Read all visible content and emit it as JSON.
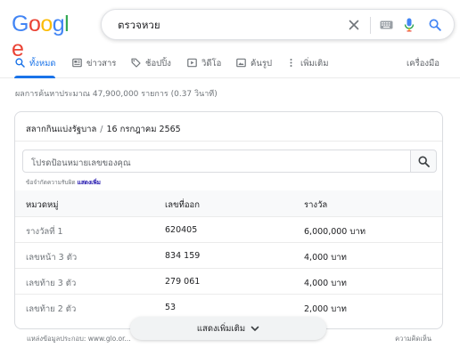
{
  "header": {
    "logo_letters": [
      {
        "ch": "G",
        "color": "#4285f4"
      },
      {
        "ch": "o",
        "color": "#ea4335"
      },
      {
        "ch": "o",
        "color": "#fbbc05"
      },
      {
        "ch": "g",
        "color": "#4285f4"
      },
      {
        "ch": "l",
        "color": "#34a853"
      },
      {
        "ch": "e",
        "color": "#ea4335"
      }
    ],
    "search_query": "ตรวจหวย",
    "icons": [
      "close-icon",
      "keyboard-icon",
      "mic-icon",
      "search-icon"
    ]
  },
  "tabs": {
    "all": "ทั้งหมด",
    "news": "ข่าวสาร",
    "shopping": "ช้อปปิ้ง",
    "videos": "วิดีโอ",
    "images": "ค้นรูป",
    "more": "เพิ่มเติม",
    "tools": "เครื่องมือ"
  },
  "result_stats": "ผลการค้นหาประมาณ 47,900,000 รายการ (0.37 วินาที)",
  "lottery": {
    "title": "สลากกินแบ่งรัฐบาล",
    "date": "16 กรกฎาคม 2565",
    "input_placeholder": "โปรดป้อนหมายเลขของคุณ",
    "disclaimer": "ข้อจำกัดความรับผิด",
    "disclaimer_link": "แสดงเพิ่ม",
    "columns": [
      "หมวดหมู่",
      "เลขที่ออก",
      "รางวัล"
    ],
    "rows": [
      [
        "รางวัลที่ 1",
        "620405",
        "6,000,000 บาท"
      ],
      [
        "เลขหน้า 3 ตัว",
        "834 159",
        "4,000 บาท"
      ],
      [
        "เลขท้าย 3 ตัว",
        "279 061",
        "4,000 บาท"
      ],
      [
        "เลขท้าย 2 ตัว",
        "53",
        "2,000 บาท"
      ]
    ],
    "show_more": "แสดงเพิ่มเติม",
    "source": "แหล่งข้อมูลประกอบ: www.glo.or...",
    "feedback": "ความคิดเห็น"
  },
  "colors": {
    "accent": "#1a73e8",
    "link": "#1a0dab"
  }
}
